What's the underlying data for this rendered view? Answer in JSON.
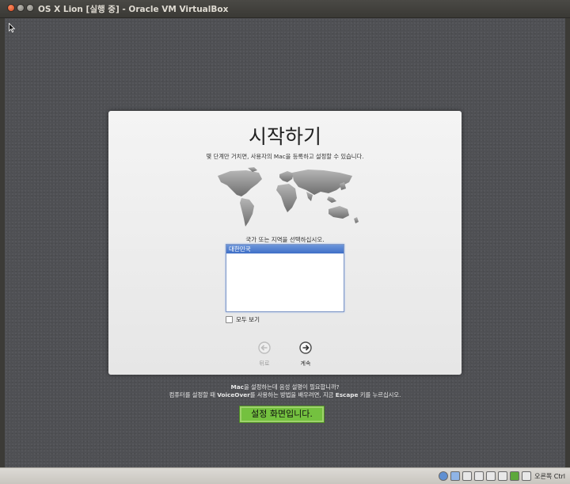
{
  "window": {
    "title": "OS X Lion [실행 중] - Oracle VM VirtualBox"
  },
  "setup": {
    "title": "시작하기",
    "subtitle": "몇 단계만 거치면, 사용자의 Mac을 등록하고 설정할 수 있습니다.",
    "region_label": "국가 또는 지역을 선택하십시오.",
    "regions": [
      "대한민국"
    ],
    "selected_region": "대한민국",
    "show_all_label": "모두 보기",
    "back_label": "뒤로",
    "continue_label": "계속"
  },
  "help": {
    "line1_bold": "Mac",
    "line1_rest": "을 설정하는데 음성 설명이 필요합니까?",
    "line2_pre": "컴퓨터를 설정할 때 ",
    "line2_bold1": "VoiceOver",
    "line2_mid": "를 사용하는 방법을 배우려면, 지금 ",
    "line2_bold2": "Escape",
    "line2_post": " 키를 누르십시오."
  },
  "caption": "설정 화면입니다.",
  "statusbar": {
    "host_key": "오른쪽 Ctrl"
  }
}
